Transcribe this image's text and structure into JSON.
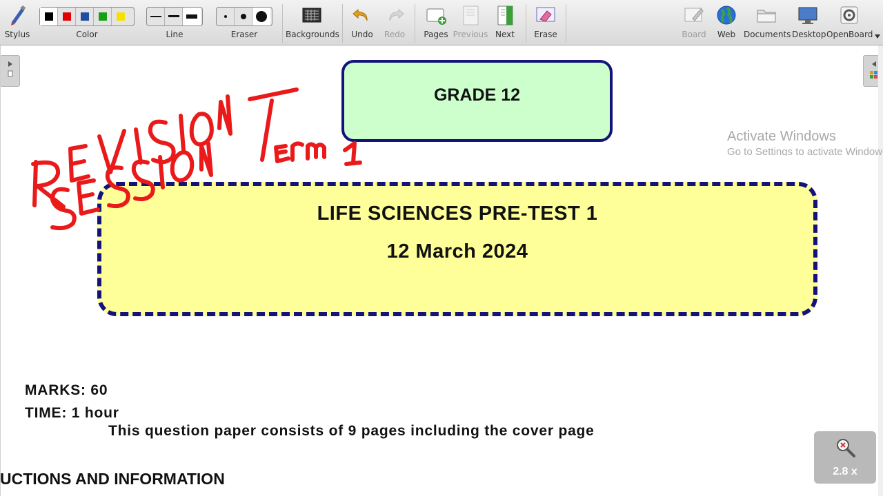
{
  "toolbar": {
    "stylus": "Stylus",
    "color": "Color",
    "line": "Line",
    "eraser": "Eraser",
    "backgrounds": "Backgrounds",
    "undo": "Undo",
    "redo": "Redo",
    "pages": "Pages",
    "previous": "Previous",
    "next": "Next",
    "erase": "Erase",
    "board": "Board",
    "web": "Web",
    "documents": "Documents",
    "desktop": "Desktop",
    "openboard": "OpenBoard",
    "colors": [
      "#000000",
      "#e00000",
      "#1f4fa0",
      "#15a015",
      "#f5e000"
    ],
    "selected_color": "#000000"
  },
  "document": {
    "grade": "GRADE 12",
    "title": "LIFE SCIENCES PRE-TEST 1",
    "date": "12 March 2024",
    "marks": "MARKS: 60",
    "time": "TIME: 1 hour",
    "pages_note": "This question paper consists of 9 pages including the cover page",
    "heading": "UCTIONS AND INFORMATION"
  },
  "annotation": {
    "word1": "REVISION",
    "word2": "SESSION",
    "word3": "TERM 1",
    "ink_color": "#ea1a1a"
  },
  "watermark": {
    "line1": "Activate Windows",
    "line2": "Go to Settings to activate Windows."
  },
  "zoom": {
    "level": "2.8 x"
  }
}
